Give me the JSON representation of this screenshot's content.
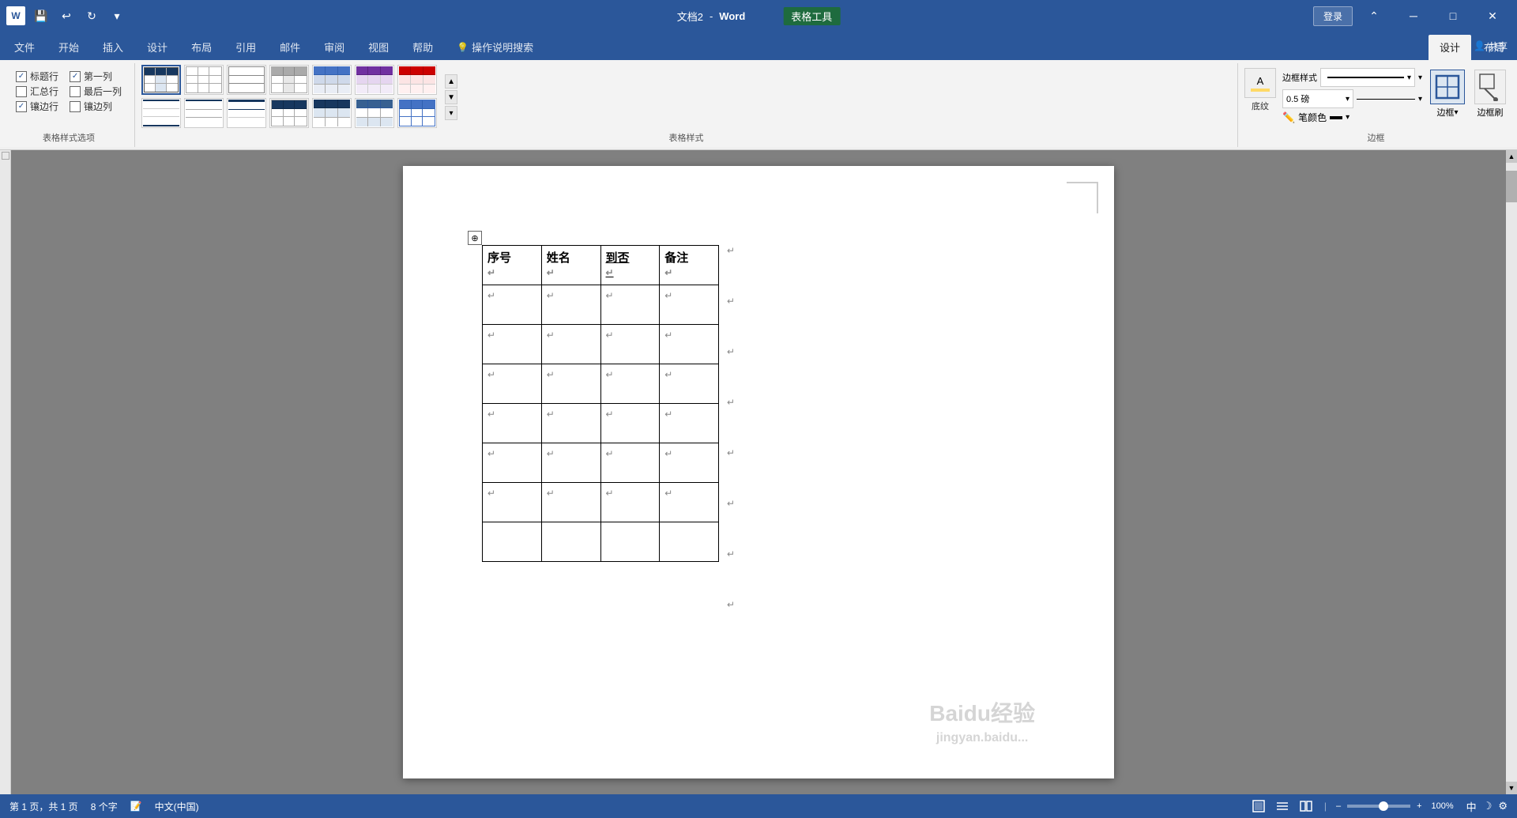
{
  "titlebar": {
    "docname": "文档2",
    "separator": " - ",
    "appname": "Word",
    "tools_label": "表格工具",
    "login_label": "登录",
    "share_label": "共享",
    "save_icon": "💾",
    "undo_icon": "↩",
    "redo_icon": "↻",
    "dropdown_icon": "▾",
    "minimize_icon": "─",
    "restore_icon": "□",
    "close_icon": "✕",
    "collapse_icon": "⌃"
  },
  "ribbon": {
    "tabs": [
      {
        "id": "file",
        "label": "文件"
      },
      {
        "id": "home",
        "label": "开始"
      },
      {
        "id": "insert",
        "label": "插入"
      },
      {
        "id": "design",
        "label": "设计"
      },
      {
        "id": "layout",
        "label": "布局"
      },
      {
        "id": "references",
        "label": "引用"
      },
      {
        "id": "mailings",
        "label": "邮件"
      },
      {
        "id": "review",
        "label": "审阅"
      },
      {
        "id": "view",
        "label": "视图"
      },
      {
        "id": "help",
        "label": "帮助"
      },
      {
        "id": "search",
        "label": "操作说明搜索"
      },
      {
        "id": "design_table",
        "label": "设计",
        "active": true
      },
      {
        "id": "layout_table",
        "label": "布局"
      }
    ],
    "groups": {
      "table_style_options": {
        "label": "表格样式选项",
        "options": [
          {
            "id": "header_row",
            "label": "标题行",
            "checked": true
          },
          {
            "id": "first_col",
            "label": "第一列",
            "checked": true
          },
          {
            "id": "total_row",
            "label": "汇总行",
            "checked": false
          },
          {
            "id": "last_col",
            "label": "最后一列",
            "checked": false
          },
          {
            "id": "banded_rows",
            "label": "镶边行",
            "checked": true
          },
          {
            "id": "banded_cols",
            "label": "镶边列",
            "checked": false
          }
        ]
      },
      "table_styles": {
        "label": "表格样式"
      },
      "borders": {
        "label": "边框",
        "shading_label": "底纹",
        "border_styles_label": "边框样式",
        "border_width_label": "0.5 磅",
        "pen_color_label": "笔颜色",
        "border_label": "边框",
        "border_painter_label": "边框刷"
      }
    }
  },
  "table": {
    "headers": [
      "序号↵",
      "姓名↵",
      "到否↵",
      "备注↵"
    ],
    "rows": 7,
    "para_mark": "↵"
  },
  "statusbar": {
    "page_info": "第 1 页，共 1 页",
    "word_count": "8 个字",
    "macro_icon": "📝",
    "lang": "中文(中国)",
    "view_modes": [
      "■",
      "≡",
      "📄"
    ],
    "zoom": "100%"
  },
  "watermark": {
    "line1": "Baidu经验",
    "line2": "jingyan.baidu..."
  }
}
